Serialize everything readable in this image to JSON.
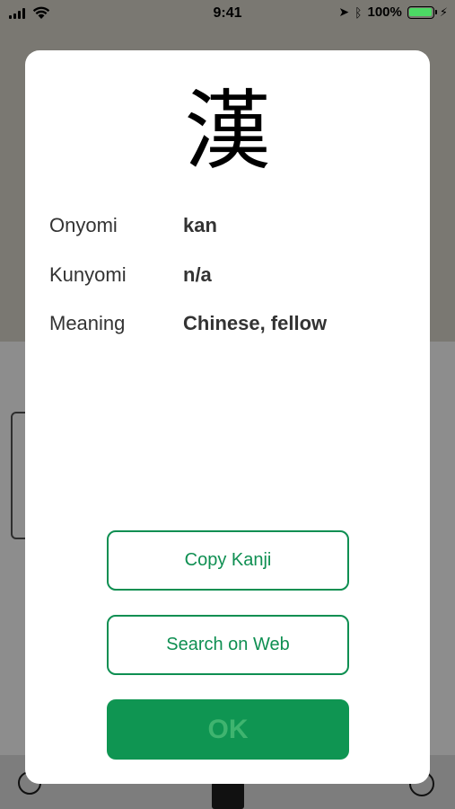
{
  "status_bar": {
    "time": "9:41",
    "battery_percent": "100%",
    "battery_level": 1.0,
    "icons": [
      "signal-icon",
      "wifi-icon",
      "location-icon",
      "bluetooth-icon",
      "battery-icon",
      "charging-icon"
    ]
  },
  "dialog": {
    "kanji": "漢",
    "rows": [
      {
        "label": "Onyomi",
        "value": "kan"
      },
      {
        "label": "Kunyomi",
        "value": "n/a"
      },
      {
        "label": "Meaning",
        "value": "Chinese, fellow"
      }
    ],
    "buttons": {
      "copy": "Copy Kanji",
      "search": "Search on Web",
      "ok": "OK"
    }
  },
  "colors": {
    "accent": "#0f8f52",
    "ok_background": "#0f9552",
    "ok_text": "#3fb46f"
  }
}
